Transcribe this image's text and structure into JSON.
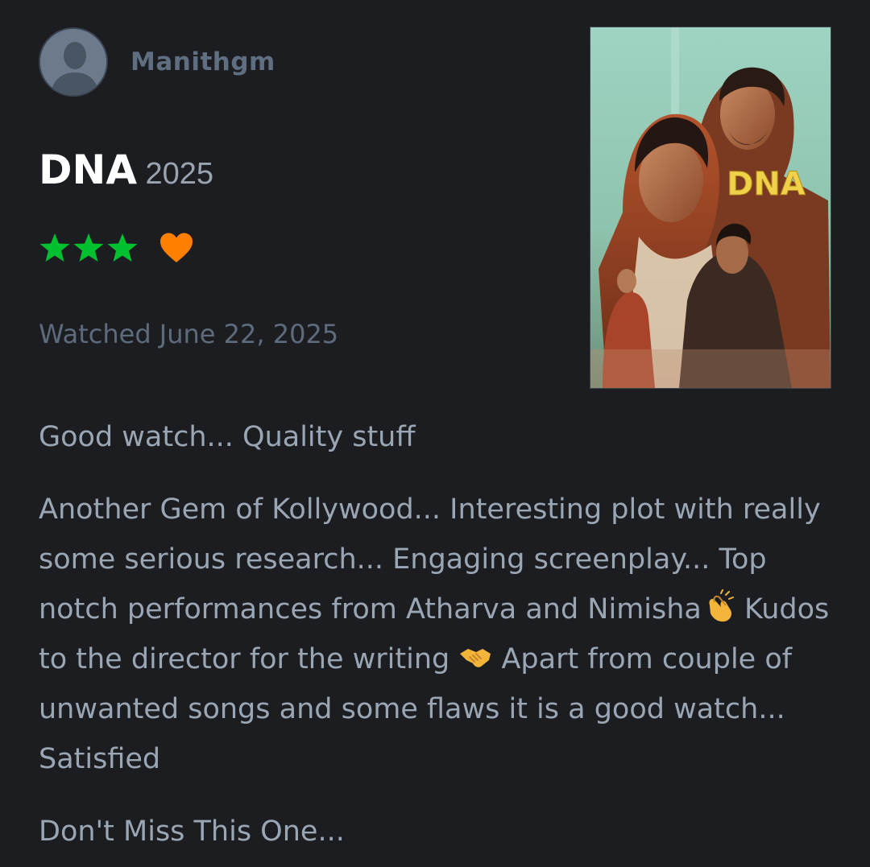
{
  "reviewer": {
    "name": "Manithgm",
    "avatar_icon": "default-user-avatar"
  },
  "film": {
    "title": "DNA",
    "year": "2025",
    "poster_title": "DNA"
  },
  "rating": {
    "stars": 3,
    "max_stars": 5,
    "liked": true,
    "star_color": "#00c030",
    "heart_color": "#ff8000"
  },
  "watched_text": "Watched June 22, 2025",
  "review": {
    "line1": "Good watch... Quality stuff",
    "para2_a": "Another Gem of Kollywood... Interesting plot with really some serious research... Engaging screenplay... Top notch performances from Atharva and Nimisha",
    "para2_b": " Kudos to the director for the writing ",
    "para2_c": " Apart from couple of unwanted songs and some flaws it is a good watch... Satisfied",
    "line3": "Don't Miss This One...",
    "emoji_1": "clapping-hands-emoji",
    "emoji_2": "handshake-emoji"
  },
  "colors": {
    "background": "#1c1d21",
    "title": "#ffffff",
    "body_text": "#9aa6b4",
    "muted": "#5d6b7c"
  }
}
